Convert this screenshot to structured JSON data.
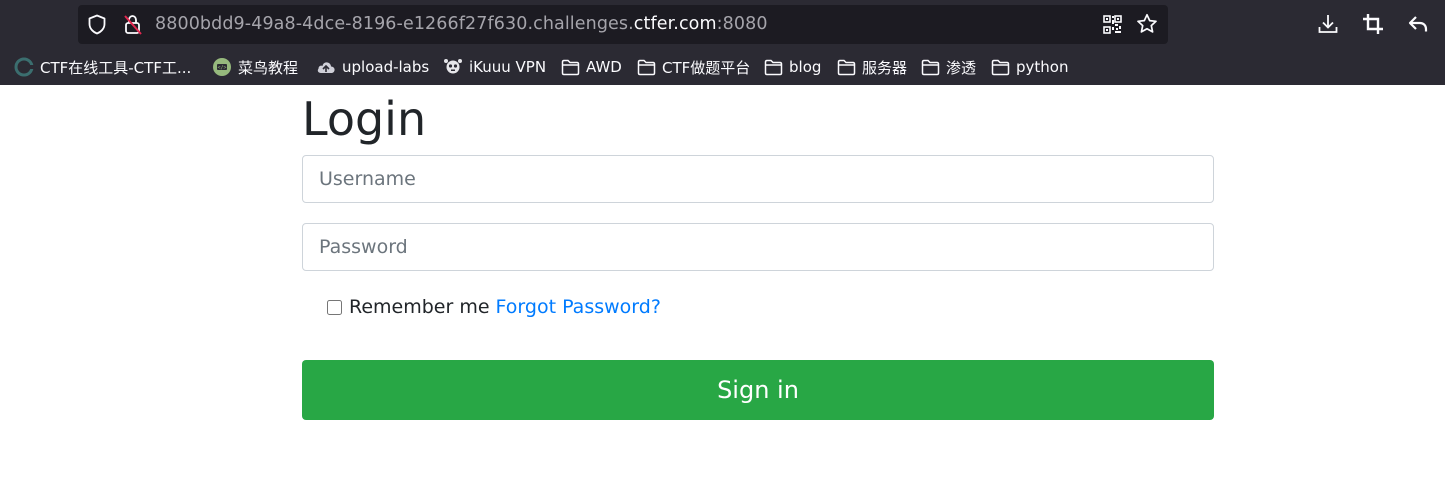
{
  "browser": {
    "url_prefix": "8800bdd9-49a8-4dce-8196-e1266f27f630.challenges.",
    "url_domain": "ctfer.com",
    "url_suffix": ":8080",
    "icons": {
      "shield": "shield-icon",
      "lock": "insecure-lock-icon",
      "qr": "qr-code-icon",
      "star": "bookmark-star-icon",
      "download": "download-icon",
      "crop": "screenshot-crop-icon",
      "back": "back-arrow-icon"
    }
  },
  "bookmarks": [
    {
      "label": "CTF在线工具-CTF工...",
      "icon": "ctf-site-icon"
    },
    {
      "label": "菜鸟教程",
      "icon": "runoob-icon"
    },
    {
      "label": "upload-labs",
      "icon": "cloud-upload-icon"
    },
    {
      "label": "iKuuu VPN",
      "icon": "vpn-site-icon"
    },
    {
      "label": "AWD",
      "icon": "folder-icon"
    },
    {
      "label": "CTF做题平台",
      "icon": "folder-icon"
    },
    {
      "label": "blog",
      "icon": "folder-icon"
    },
    {
      "label": "服务器",
      "icon": "folder-icon"
    },
    {
      "label": "渗透",
      "icon": "folder-icon"
    },
    {
      "label": "python",
      "icon": "folder-icon"
    }
  ],
  "login": {
    "title": "Login",
    "username_placeholder": "Username",
    "username_value": "",
    "password_placeholder": "Password",
    "password_value": "",
    "remember_label": "Remember me",
    "remember_checked": false,
    "forgot_link": "Forgot Password?",
    "signin_label": "Sign in"
  },
  "colors": {
    "chrome_bg": "#2b2a33",
    "urlbar_bg": "#1c1b22",
    "signin_green": "#28a745",
    "link_blue": "#007bff"
  }
}
